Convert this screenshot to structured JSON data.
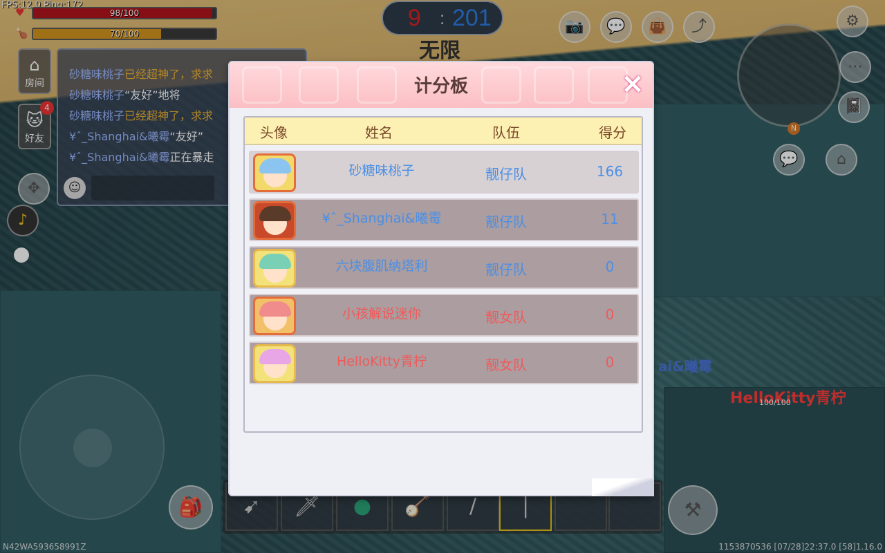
{
  "hud": {
    "fps_text": "FPS:12.0  Ping:172",
    "health_text": "98/100",
    "health_fraction": 0.98,
    "hunger_text": "70/100",
    "hunger_fraction": 0.7,
    "score_left": "9",
    "score_sep": ":",
    "score_right": "201",
    "time_mode": "无限",
    "room_label": "房间",
    "friend_label": "好友",
    "friend_badge": "4",
    "device_id": "N42WA593658991Z",
    "bottom_right": "1153870536    [07/28]22:37.0    [58]1.16.0",
    "player_tag": "HelloKitty青柠",
    "player_hp": "100/100",
    "player_name_partial": "ai&曦霉",
    "minimap_dir": "N"
  },
  "chat": {
    "lines": [
      {
        "name": "砂糖味桃子",
        "msg": "已经超神了，求求"
      },
      {
        "name": "砂糖味桃子",
        "msg": "“友好”地将"
      },
      {
        "name": "砂糖味桃子",
        "msg": "已经超神了，求求"
      },
      {
        "name": "¥ˆ_Shanghai&曦霉",
        "msg": "“友好”"
      },
      {
        "name": "¥ˆ_Shanghai&曦霉",
        "msg": "正在暴走"
      }
    ]
  },
  "scoreboard": {
    "title": "计分板",
    "close_icon": "×",
    "headers": {
      "avatar": "头像",
      "name": "姓名",
      "team": "队伍",
      "score": "得分"
    },
    "rows": [
      {
        "name": "砂糖味桃子",
        "team": "靓仔队",
        "score": "166",
        "color": "#4a8fe6"
      },
      {
        "name": "¥ˆ_Shanghai&曦霉",
        "team": "靓仔队",
        "score": "11",
        "color": "#4a8fe6"
      },
      {
        "name": "六块腹肌纳塔利",
        "team": "靓仔队",
        "score": "0",
        "color": "#4a8fe6"
      },
      {
        "name": "小孩解说迷你",
        "team": "靓女队",
        "score": "0",
        "color": "#f05a5a"
      },
      {
        "name": "HelloKitty青柠",
        "team": "靓女队",
        "score": "0",
        "color": "#f05a5a"
      }
    ]
  }
}
